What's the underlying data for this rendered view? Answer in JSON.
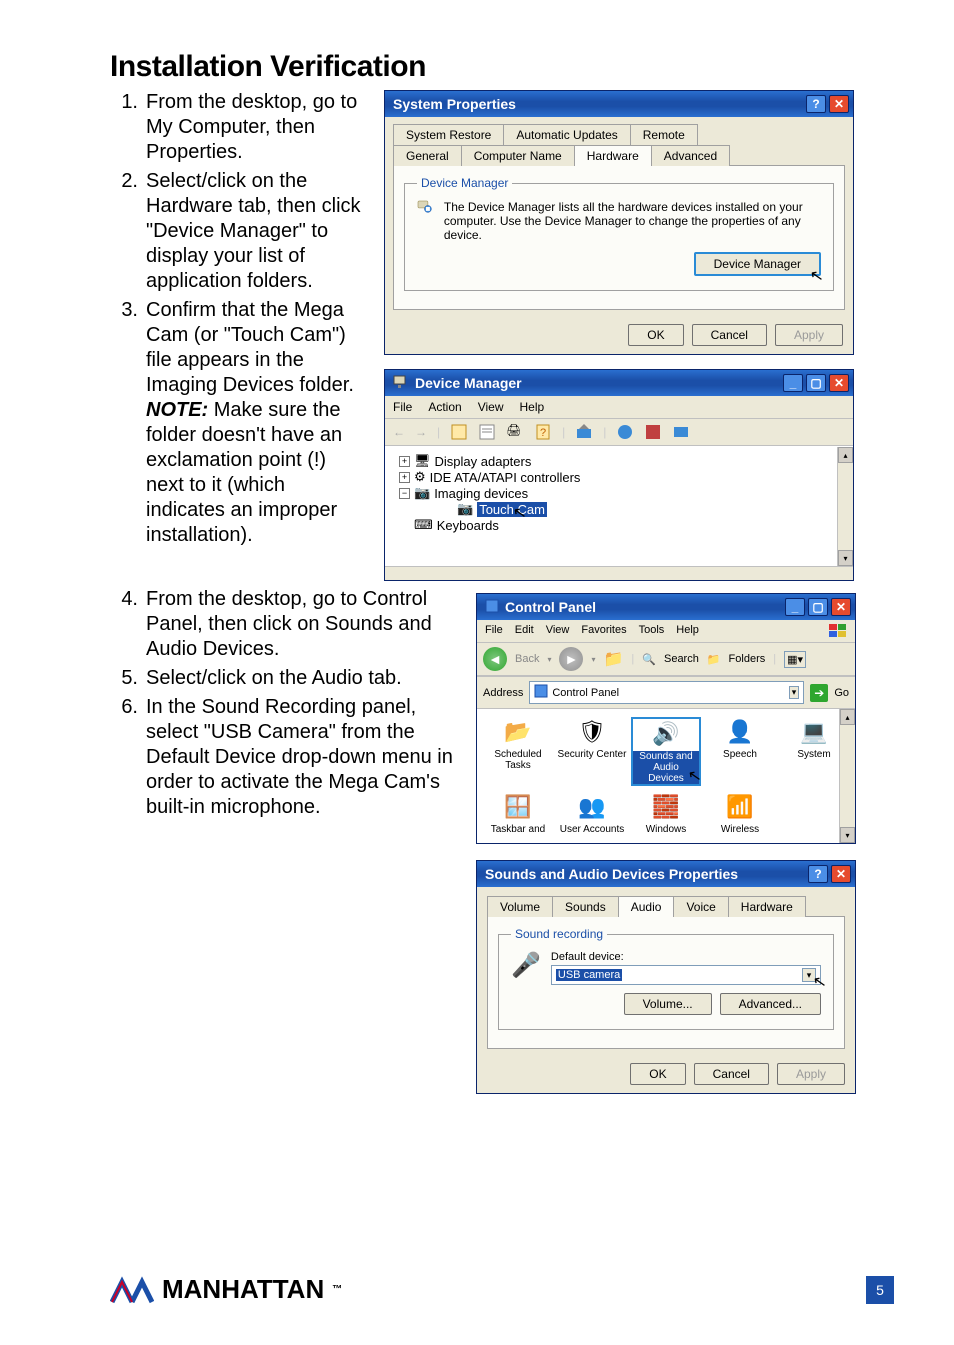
{
  "heading": "Installation Verification",
  "steps": [
    {
      "n": "1.",
      "text": "From the desktop, go to My Computer, then Properties."
    },
    {
      "n": "2.",
      "text": "Select/click on the Hardware tab, then click \"Device Manager\" to display your list of application folders."
    },
    {
      "n": "3.",
      "pre": "Confirm that the Mega Cam (or \"Touch Cam\") file appears in the Imaging Devices folder. ",
      "note": "NOTE:",
      "post": " Make sure the folder doesn't have an exclamation point (!) next to it (which indicates an improper installation)."
    },
    {
      "n": "4.",
      "text": "From the desktop, go to Control Panel, then click on Sounds and Audio Devices."
    },
    {
      "n": "5.",
      "text": "Select/click on the Audio tab."
    },
    {
      "n": "6.",
      "text": "In the Sound Recording panel, select \"USB Camera\" from the Default Device drop-down menu in order to activate the Mega Cam's built-in microphone."
    }
  ],
  "sysprop": {
    "title": "System Properties",
    "tabs_row1": [
      "System Restore",
      "Automatic Updates",
      "Remote"
    ],
    "tabs_row2": [
      "General",
      "Computer Name",
      "Hardware",
      "Advanced"
    ],
    "active_tab": "Hardware",
    "group": "Device Manager",
    "desc": "The Device Manager lists all the hardware devices installed on your computer. Use the Device Manager to change the properties of any device.",
    "btn_devmgr": "Device Manager",
    "btn_ok": "OK",
    "btn_cancel": "Cancel",
    "btn_apply": "Apply"
  },
  "devmgr": {
    "title": "Device Manager",
    "menus": [
      "File",
      "Action",
      "View",
      "Help"
    ],
    "nodes": {
      "display": "Display adapters",
      "ide": "IDE ATA/ATAPI controllers",
      "imaging": "Imaging devices",
      "touchcam": "Touch Cam",
      "keyboards": "Keyboards"
    }
  },
  "cpanel": {
    "title": "Control Panel",
    "menus": [
      "File",
      "Edit",
      "View",
      "Favorites",
      "Tools",
      "Help"
    ],
    "back": "Back",
    "search": "Search",
    "folders": "Folders",
    "address_label": "Address",
    "address_value": "Control Panel",
    "go": "Go",
    "icons_row1": [
      "Scheduled Tasks",
      "Security Center",
      "Sounds and Audio Devices",
      "Speech",
      "System"
    ],
    "icons_row2": [
      "Taskbar and",
      "User Accounts",
      "Windows",
      "Wireless"
    ]
  },
  "sounds": {
    "title": "Sounds and Audio Devices Properties",
    "tabs": [
      "Volume",
      "Sounds",
      "Audio",
      "Voice",
      "Hardware"
    ],
    "active_tab": "Audio",
    "group": "Sound recording",
    "default_label": "Default device:",
    "default_value": "USB camera",
    "btn_volume": "Volume...",
    "btn_advanced": "Advanced...",
    "btn_ok": "OK",
    "btn_cancel": "Cancel",
    "btn_apply": "Apply"
  },
  "footer": {
    "brand": "MANHATTAN",
    "page": "5"
  }
}
